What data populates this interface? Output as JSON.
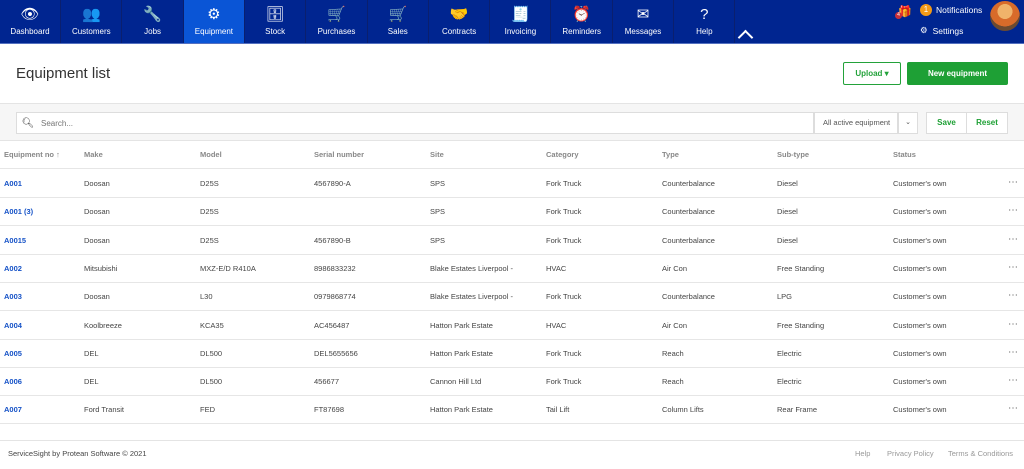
{
  "nav": {
    "items": [
      {
        "label": "Dashboard",
        "icon": "eye-icon",
        "glyph": "👁"
      },
      {
        "label": "Customers",
        "icon": "users-icon",
        "glyph": "👥"
      },
      {
        "label": "Jobs",
        "icon": "wrench-icon",
        "glyph": "🔧"
      },
      {
        "label": "Equipment",
        "icon": "equipment-icon",
        "glyph": "⚙"
      },
      {
        "label": "Stock",
        "icon": "stock-icon",
        "glyph": "🗄"
      },
      {
        "label": "Purchases",
        "icon": "cart-down-icon",
        "glyph": "🛒"
      },
      {
        "label": "Sales",
        "icon": "cart-up-icon",
        "glyph": "🛒"
      },
      {
        "label": "Contracts",
        "icon": "handshake-icon",
        "glyph": "🤝"
      },
      {
        "label": "Invoicing",
        "icon": "invoice-icon",
        "glyph": "🧾"
      },
      {
        "label": "Reminders",
        "icon": "alarm-clock-icon",
        "glyph": "⏰"
      },
      {
        "label": "Messages",
        "icon": "envelope-icon",
        "glyph": "✉"
      },
      {
        "label": "Help",
        "icon": "question-icon",
        "glyph": "?"
      }
    ],
    "active": "Equipment",
    "gift_count": "4",
    "notifications_count": "1",
    "notifications_label": "Notifications",
    "settings_label": "Settings"
  },
  "page": {
    "title": "Equipment list",
    "upload_label": "Upload",
    "new_label": "New equipment"
  },
  "search": {
    "placeholder": "Search...",
    "filter": "All active equipment",
    "save": "Save",
    "reset": "Reset"
  },
  "table": {
    "headers": [
      "Equipment no ↑",
      "Make",
      "Model",
      "Serial number",
      "Site",
      "Category",
      "Type",
      "Sub-type",
      "Status"
    ],
    "rows": [
      [
        "A001",
        "Doosan",
        "D25S",
        "4567890-A",
        "SPS",
        "Fork Truck",
        "Counterbalance",
        "Diesel",
        "Customer's own"
      ],
      [
        "A001 (3)",
        "Doosan",
        "D25S",
        "",
        "SPS",
        "Fork Truck",
        "Counterbalance",
        "Diesel",
        "Customer's own"
      ],
      [
        "A0015",
        "Doosan",
        "D25S",
        "4567890-B",
        "SPS",
        "Fork Truck",
        "Counterbalance",
        "Diesel",
        "Customer's own"
      ],
      [
        "A002",
        "Mitsubishi",
        "MXZ-E/D R410A",
        "8986833232",
        "Blake Estates Liverpool -",
        "HVAC",
        "Air Con",
        "Free Standing",
        "Customer's own"
      ],
      [
        "A003",
        "Doosan",
        "L30",
        "0979868774",
        "Blake Estates Liverpool -",
        "Fork Truck",
        "Counterbalance",
        "LPG",
        "Customer's own"
      ],
      [
        "A004",
        "Koolbreeze",
        "KCA35",
        "AC456487",
        "Hatton Park Estate",
        "HVAC",
        "Air Con",
        "Free Standing",
        "Customer's own"
      ],
      [
        "A005",
        "DEL",
        "DL500",
        "DEL5655656",
        "Hatton Park Estate",
        "Fork Truck",
        "Reach",
        "Electric",
        "Customer's own"
      ],
      [
        "A006",
        "DEL",
        "DL500",
        "456677",
        "Cannon Hill Ltd",
        "Fork Truck",
        "Reach",
        "Electric",
        "Customer's own"
      ],
      [
        "A007",
        "Ford Transit",
        "FED",
        "FT87698",
        "Hatton Park Estate",
        "Tail Lift",
        "Column Lifts",
        "Rear Frame",
        "Customer's own"
      ]
    ]
  },
  "footer": {
    "copyright": "ServiceSight by Protean Software © 2021",
    "links": [
      "Help",
      "Privacy Policy",
      "Terms & Conditions"
    ]
  },
  "colors": {
    "nav": "#002590",
    "active": "#0a55d6",
    "primary": "#1ea035",
    "link": "#1552c7"
  }
}
